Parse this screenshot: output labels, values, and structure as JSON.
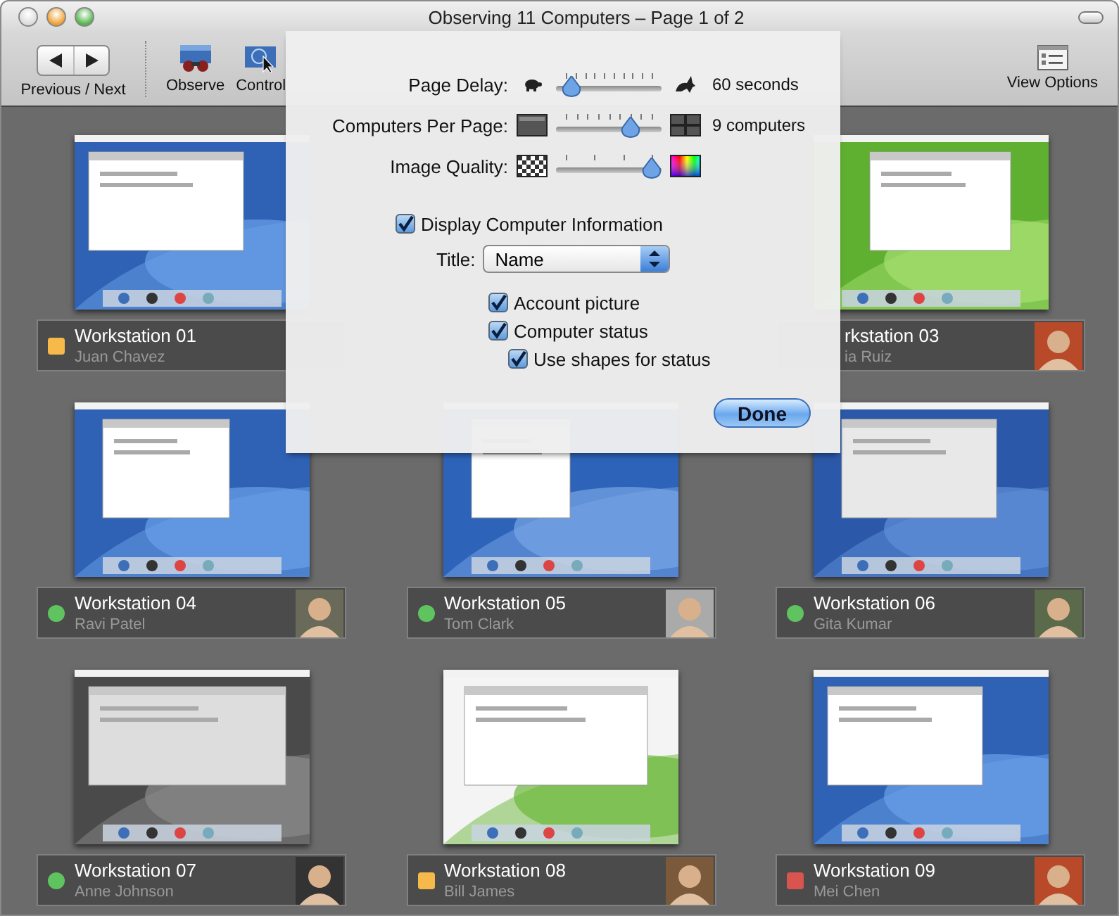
{
  "window": {
    "title": "Observing 11 Computers – Page 1 of 2"
  },
  "toolbar": {
    "nav_label": "Previous / Next",
    "items": [
      {
        "kind": "observe",
        "label": "Observe"
      },
      {
        "kind": "control",
        "label": "Control"
      },
      {
        "kind": "options",
        "label": "View Options"
      }
    ]
  },
  "sheet": {
    "sliders": [
      {
        "kind": "delay",
        "label": "Page Delay:",
        "level": 0.07,
        "reading": "60 seconds"
      },
      {
        "kind": "count",
        "label": "Computers Per Page:",
        "level": 0.75,
        "reading": "9 computers"
      },
      {
        "kind": "quality",
        "label": "Image Quality:",
        "level": 1
      }
    ],
    "display_info": {
      "label": "Display Computer Information",
      "checked": true
    },
    "title_popup": {
      "label": "Title:",
      "value": "Name"
    },
    "details": [
      {
        "label": "Account picture",
        "checked": true
      },
      {
        "label": "Computer status",
        "checked": true,
        "children": [
          {
            "label": "Use shapes for status",
            "checked": true
          }
        ]
      }
    ],
    "done_button": "Done"
  },
  "computers": {
    "rows": [
      {
        "items": [
          {
            "name": "Workstation 01",
            "user": "Juan Chavez",
            "color": "#f6b94a",
            "kind": "square"
          },
          {
            "name": "rkstation 03",
            "user": "ia Ruiz"
          }
        ]
      },
      {
        "items": [
          {
            "name": "Workstation 04",
            "user": "Ravi Patel",
            "color": "#5fc35f",
            "kind": "circle"
          },
          {
            "name": "Workstation 05",
            "user": "Tom Clark",
            "color": "#5fc35f",
            "kind": "circle"
          },
          {
            "name": "Workstation 06",
            "user": "Gita Kumar",
            "color": "#5fc35f",
            "kind": "circle"
          }
        ]
      },
      {
        "items": [
          {
            "name": "Workstation 07",
            "user": "Anne Johnson",
            "color": "#5fc35f",
            "kind": "circle"
          },
          {
            "name": "Workstation 08",
            "user": "Bill James",
            "color": "#f6b94a",
            "kind": "square"
          },
          {
            "name": "Workstation 09",
            "user": "Mei Chen",
            "color": "#d9534f",
            "kind": "square"
          }
        ]
      }
    ]
  }
}
